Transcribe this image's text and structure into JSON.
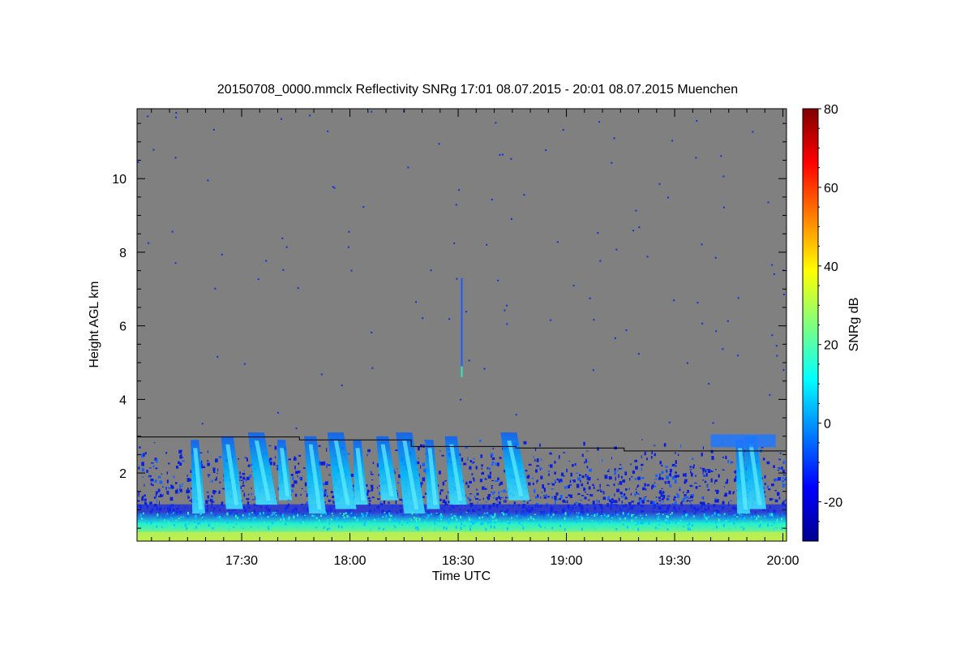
{
  "chart_data": {
    "type": "heatmap",
    "title": "20150708_0000.mmclx Reflectivity SNRg   17:01 08.07.2015 - 20:01 08.07.2015 Muenchen",
    "xlabel": "Time UTC",
    "ylabel": "Height AGL km",
    "colorbar_label": "SNRg dB",
    "x_range": [
      "17:01",
      "20:01"
    ],
    "x_ticks": [
      "17:30",
      "18:00",
      "18:30",
      "19:00",
      "19:30",
      "20:00"
    ],
    "y_range": [
      0.15,
      11.9
    ],
    "y_ticks": [
      2,
      4,
      6,
      8,
      10
    ],
    "colorbar_range": [
      -30,
      80
    ],
    "colorbar_ticks": [
      -20,
      0,
      20,
      40,
      60,
      80
    ],
    "background_color": "#808080",
    "colormap": "jet",
    "features": {
      "surface_layer": {
        "height_km": [
          0.15,
          0.4
        ],
        "snr_db": [
          25,
          35
        ]
      },
      "boundary_layer": {
        "top_km": [
          2.6,
          3.0
        ],
        "snr_db": [
          -20,
          10
        ]
      },
      "virga_fall_streaks_times": [
        "17:17",
        "17:26",
        "17:34",
        "17:41",
        "17:49",
        "17:56",
        "18:02",
        "18:09",
        "18:15",
        "18:22",
        "18:28",
        "18:44",
        "19:48",
        "19:51"
      ],
      "vertical_streak": {
        "time": "18:31",
        "height_km": [
          4.6,
          7.3
        ]
      }
    },
    "boundary_layer_height_line": [
      {
        "x_start": "17:01",
        "x_end": "17:46",
        "height_km": 2.98
      },
      {
        "x_start": "17:46",
        "x_end": "18:17",
        "height_km": 2.9
      },
      {
        "x_start": "18:17",
        "x_end": "18:46",
        "height_km": 2.72
      },
      {
        "x_start": "18:46",
        "x_end": "19:16",
        "height_km": 2.68
      },
      {
        "x_start": "19:16",
        "x_end": "20:01",
        "height_km": 2.6
      }
    ]
  }
}
